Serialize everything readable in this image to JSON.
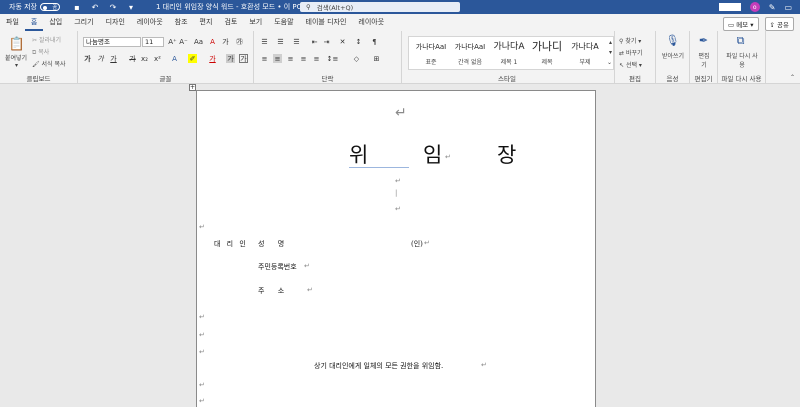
{
  "titlebar": {
    "autosave_label": "자동 저장",
    "autosave_state": "끔",
    "doc_title": "1 대리인 위임장 양식 워드 - 호환성 모드 • 이 PC에 저장됨",
    "search_placeholder": "검색(Alt+Q)",
    "avatar_letter": "o"
  },
  "menu": {
    "tabs": [
      "파일",
      "홈",
      "삽입",
      "그리기",
      "디자인",
      "레이아웃",
      "참조",
      "편지",
      "검토",
      "보기",
      "도움말",
      "테이블 디자인",
      "레이아웃"
    ],
    "active_index": 1,
    "memo_label": "메모",
    "share_label": "공유"
  },
  "ribbon": {
    "clipboard": {
      "paste": "붙여넣기",
      "cut": "잘라내기",
      "copy": "복사",
      "format_painter": "서식 복사",
      "label": "클립보드"
    },
    "font": {
      "font_name": "나눔명조",
      "font_size": "11",
      "label": "글꼴"
    },
    "paragraph": {
      "label": "단락"
    },
    "styles": {
      "items": [
        {
          "preview": "가나다AaI",
          "name": "표준"
        },
        {
          "preview": "가나다AaI",
          "name": "간격 없음"
        },
        {
          "preview": "가나다A",
          "name": "제목 1"
        },
        {
          "preview": "가나디",
          "name": "제목"
        },
        {
          "preview": "가나다A",
          "name": "부제"
        }
      ],
      "label": "스타일"
    },
    "editing": {
      "find": "찾기",
      "replace": "바꾸기",
      "select": "선택",
      "label": "편집"
    },
    "voice": {
      "dictate": "받아쓰기",
      "label": "음성"
    },
    "editor": {
      "editor": "편집기",
      "label": "편집기"
    },
    "reuse": {
      "reuse": "파일 다시 사용",
      "label": "파일 다시 사용"
    }
  },
  "document": {
    "title": "위 임 장",
    "agent_label": "대 리 인",
    "name_label": "성      명",
    "seal_label": "(인)",
    "rrn_label": "주민등록번호",
    "address_label": "주      소",
    "delegation_statement": "상기 대리인에게 일체의 모든 권한을 위임함."
  }
}
